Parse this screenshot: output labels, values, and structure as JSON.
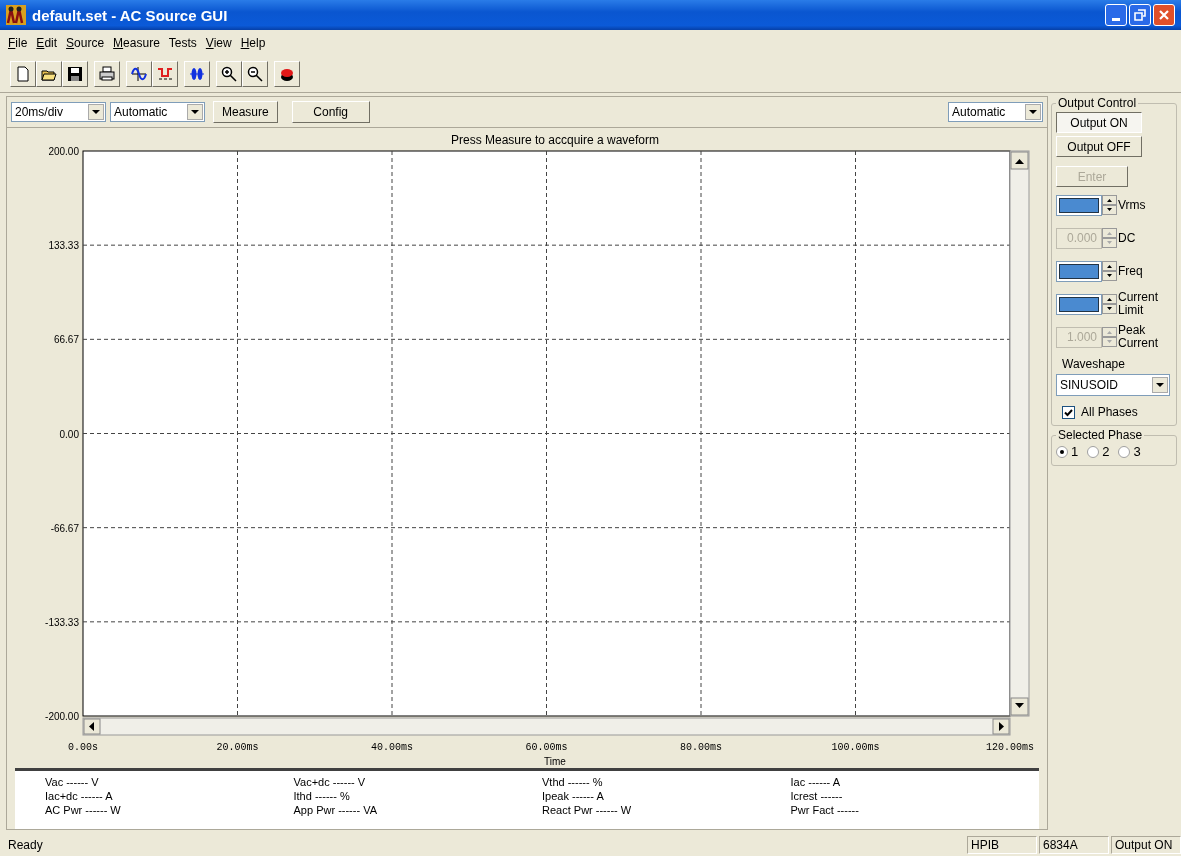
{
  "window": {
    "title": "default.set - AC Source GUI"
  },
  "menu": [
    {
      "label": "File",
      "mnemonic": true
    },
    {
      "label": "Edit",
      "mnemonic": true
    },
    {
      "label": "Source",
      "mnemonic": true
    },
    {
      "label": "Measure",
      "mnemonic": true
    },
    {
      "label": "Tests",
      "mnemonic": false
    },
    {
      "label": "View",
      "mnemonic": true
    },
    {
      "label": "Help",
      "mnemonic": true
    }
  ],
  "controls": {
    "timebase": "20ms/div",
    "trigger": "Automatic",
    "buttons": [
      "Measure",
      "Config"
    ],
    "scale": "Automatic"
  },
  "chart": {
    "chart_data": {
      "type": "line",
      "grid": true,
      "title": "Press Measure to accquire a waveform",
      "xlabel": "Time",
      "xlim": [
        0,
        120
      ],
      "ylim": [
        -200,
        200
      ],
      "xticks": [
        {
          "value": 0,
          "label": "0.00s"
        },
        {
          "value": 20,
          "label": "20.00ms"
        },
        {
          "value": 40,
          "label": "40.00ms"
        },
        {
          "value": 60,
          "label": "60.00ms"
        },
        {
          "value": 80,
          "label": "80.00ms"
        },
        {
          "value": 100,
          "label": "100.00ms"
        },
        {
          "value": 120,
          "label": "120.00ms"
        }
      ],
      "yticks": [
        {
          "value": 200,
          "label": "200.00"
        },
        {
          "value": 133.33,
          "label": "133.33"
        },
        {
          "value": 66.67,
          "label": "66.67"
        },
        {
          "value": 0,
          "label": "0.00"
        },
        {
          "value": -66.67,
          "label": "-66.67"
        },
        {
          "value": -133.33,
          "label": "-133.33"
        },
        {
          "value": -200,
          "label": "-200.00"
        }
      ]
    }
  },
  "readings": [
    [
      "Vac ------ V",
      "Iac+dc ------ A",
      "AC Pwr ------ W"
    ],
    [
      "Vac+dc ------ V",
      "Ithd ------ %",
      "App Pwr ------ VA"
    ],
    [
      "Vthd ------ %",
      "Ipeak ------ A",
      "React Pwr ------ W"
    ],
    [
      "Iac ------ A",
      "Icrest ------",
      "Pwr Fact ------"
    ]
  ],
  "output_control": {
    "title": "Output Control",
    "buttons": [
      {
        "label": "Output ON",
        "pressed": true,
        "disabled": false
      },
      {
        "label": "Output OFF",
        "pressed": false,
        "disabled": false
      },
      {
        "label": "Enter",
        "pressed": false,
        "disabled": true
      }
    ],
    "spins": [
      {
        "label": "Vrms",
        "disabled": false,
        "highlighted": true
      },
      {
        "label": "DC",
        "value": "0.000",
        "disabled": true,
        "highlighted": false
      },
      {
        "label": "Freq",
        "disabled": false,
        "highlighted": true
      },
      {
        "label": "Current Limit",
        "disabled": false,
        "highlighted": true
      },
      {
        "label": "Peak Current",
        "value": "1.000",
        "disabled": true,
        "highlighted": false
      }
    ],
    "waveshape": {
      "label": "Waveshape",
      "value": "SINUSOID"
    },
    "all_phases": {
      "label": "All Phases",
      "checked": true
    }
  },
  "selected_phase": {
    "title": "Selected Phase",
    "options": [
      {
        "label": "1",
        "selected": true
      },
      {
        "label": "2",
        "selected": false
      },
      {
        "label": "3",
        "selected": false
      }
    ]
  },
  "status_bar": [
    "Ready",
    "HPIB",
    "6834A",
    "Output ON"
  ]
}
